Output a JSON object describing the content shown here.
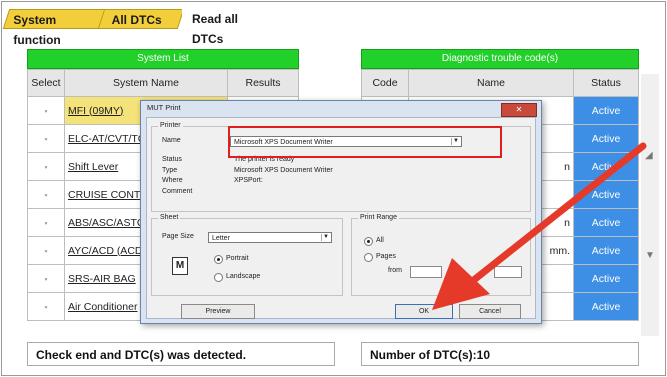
{
  "tabs": [
    "System function",
    "All DTCs",
    "Read all DTCs"
  ],
  "left_table": {
    "header": "System List",
    "columns": [
      "Select",
      "System Name",
      "Results"
    ],
    "rows": [
      {
        "select": "▪",
        "name": "MFI (09MY)",
        "highlight": true
      },
      {
        "select": "▪",
        "name": "ELC-AT/CVT/TC",
        "highlight": false
      },
      {
        "select": "▪",
        "name": "Shift Lever",
        "highlight": false
      },
      {
        "select": "▪",
        "name": "CRUISE CONTR",
        "highlight": false
      },
      {
        "select": "▪",
        "name": "ABS/ASC/ASTC",
        "highlight": false
      },
      {
        "select": "▪",
        "name": "AYC/ACD (ACD",
        "highlight": false
      },
      {
        "select": "▪",
        "name": "SRS-AIR BAG",
        "highlight": false
      },
      {
        "select": "▪",
        "name": "Air Conditioner",
        "highlight": false
      }
    ]
  },
  "right_table": {
    "header": "Diagnostic trouble code(s)",
    "columns": [
      "Code",
      "Name",
      "Status"
    ],
    "rows": [
      {
        "code": "",
        "name": "",
        "status": "Active"
      },
      {
        "code": "",
        "name": "",
        "status": "Active"
      },
      {
        "code": "",
        "name": "n",
        "status": "Active"
      },
      {
        "code": "",
        "name": "",
        "status": "Active"
      },
      {
        "code": "",
        "name": "n",
        "status": "Active"
      },
      {
        "code": "",
        "name": "mm.",
        "status": "Active"
      },
      {
        "code": "",
        "name": "",
        "status": "Active"
      },
      {
        "code": "",
        "name": "",
        "status": "Active"
      }
    ]
  },
  "footer": {
    "left": "Check end and DTC(s) was detected.",
    "right": "Number of DTC(s):10"
  },
  "dialog": {
    "title": "MUT Print",
    "printer_group": "Printer",
    "name_label": "Name",
    "name_value": "Microsoft XPS Document Writer",
    "status_label": "Status",
    "status_value": "The printer is ready",
    "type_label": "Type",
    "type_value": "Microsoft XPS Document Writer",
    "where_label": "Where",
    "where_value": "XPSPort:",
    "comment_label": "Comment",
    "sheet_group": "Sheet",
    "page_size_label": "Page Size",
    "page_size_value": "Letter",
    "portrait": "Portrait",
    "landscape": "Landscape",
    "print_range_group": "Print Range",
    "all_label": "All",
    "pages_label": "Pages",
    "from_label": "from",
    "preview": "Preview",
    "ok": "OK",
    "cancel": "Cancel",
    "icon_letter": "M"
  },
  "colors": {
    "tab_yellow": "#f2cf3a",
    "header_green": "#22d02a",
    "status_blue": "#3d8fe6",
    "highlight_red": "#e02020"
  }
}
